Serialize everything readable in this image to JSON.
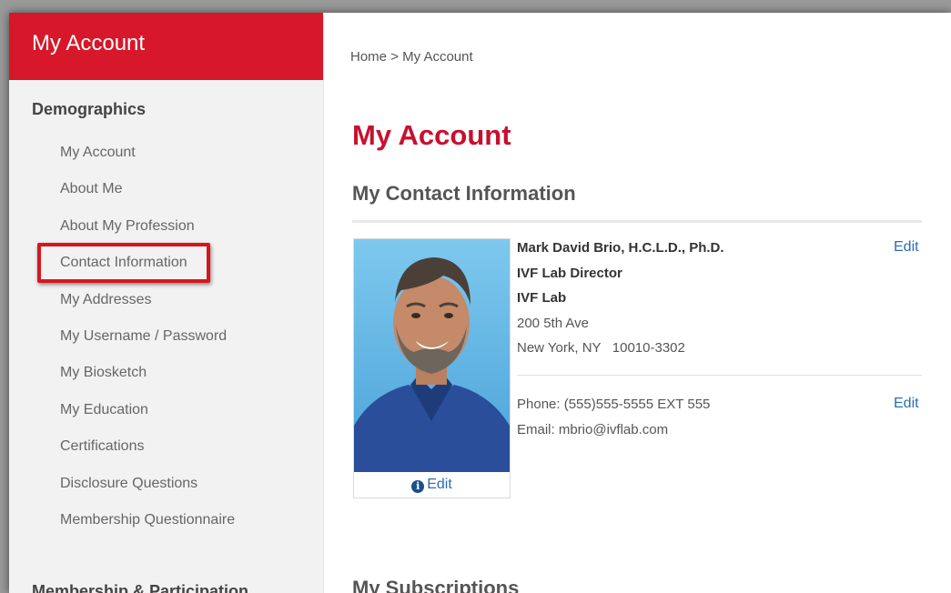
{
  "sidebar": {
    "title": "My Account",
    "section_demographics": "Demographics",
    "items": [
      {
        "label": "My Account"
      },
      {
        "label": "About Me"
      },
      {
        "label": "About My Profession"
      },
      {
        "label": "Contact Information",
        "highlighted": true
      },
      {
        "label": "My Addresses"
      },
      {
        "label": "My Username / Password"
      },
      {
        "label": "My Biosketch"
      },
      {
        "label": "My Education"
      },
      {
        "label": "Certifications"
      },
      {
        "label": "Disclosure Questions"
      },
      {
        "label": "Membership Questionnaire"
      }
    ],
    "section_membership": "Membership & Participation"
  },
  "breadcrumb": {
    "home": "Home",
    "separator": ">",
    "current": "My Account"
  },
  "main": {
    "page_title": "My Account",
    "contact_section_title": "My Contact Information",
    "photo_edit_label": "Edit",
    "contact": {
      "name": "Mark David Brio, H.C.L.D., Ph.D.",
      "job_title": "IVF Lab Director",
      "organization": "IVF Lab",
      "address_line1": "200 5th Ave",
      "address_line2": "New York, NY   10010-3302",
      "edit_label": "Edit"
    },
    "phone_email": {
      "phone": "Phone: (555)555-5555 EXT 555",
      "email": "Email: mbrio@ivflab.com",
      "edit_label": "Edit"
    },
    "subscriptions_title": "My Subscriptions"
  },
  "colors": {
    "brand_red": "#d6182a",
    "title_red": "#c8102e",
    "link_blue": "#2a6db5",
    "highlight_box": "#d9151c"
  },
  "icons": {
    "photo_edit": "info-icon"
  }
}
